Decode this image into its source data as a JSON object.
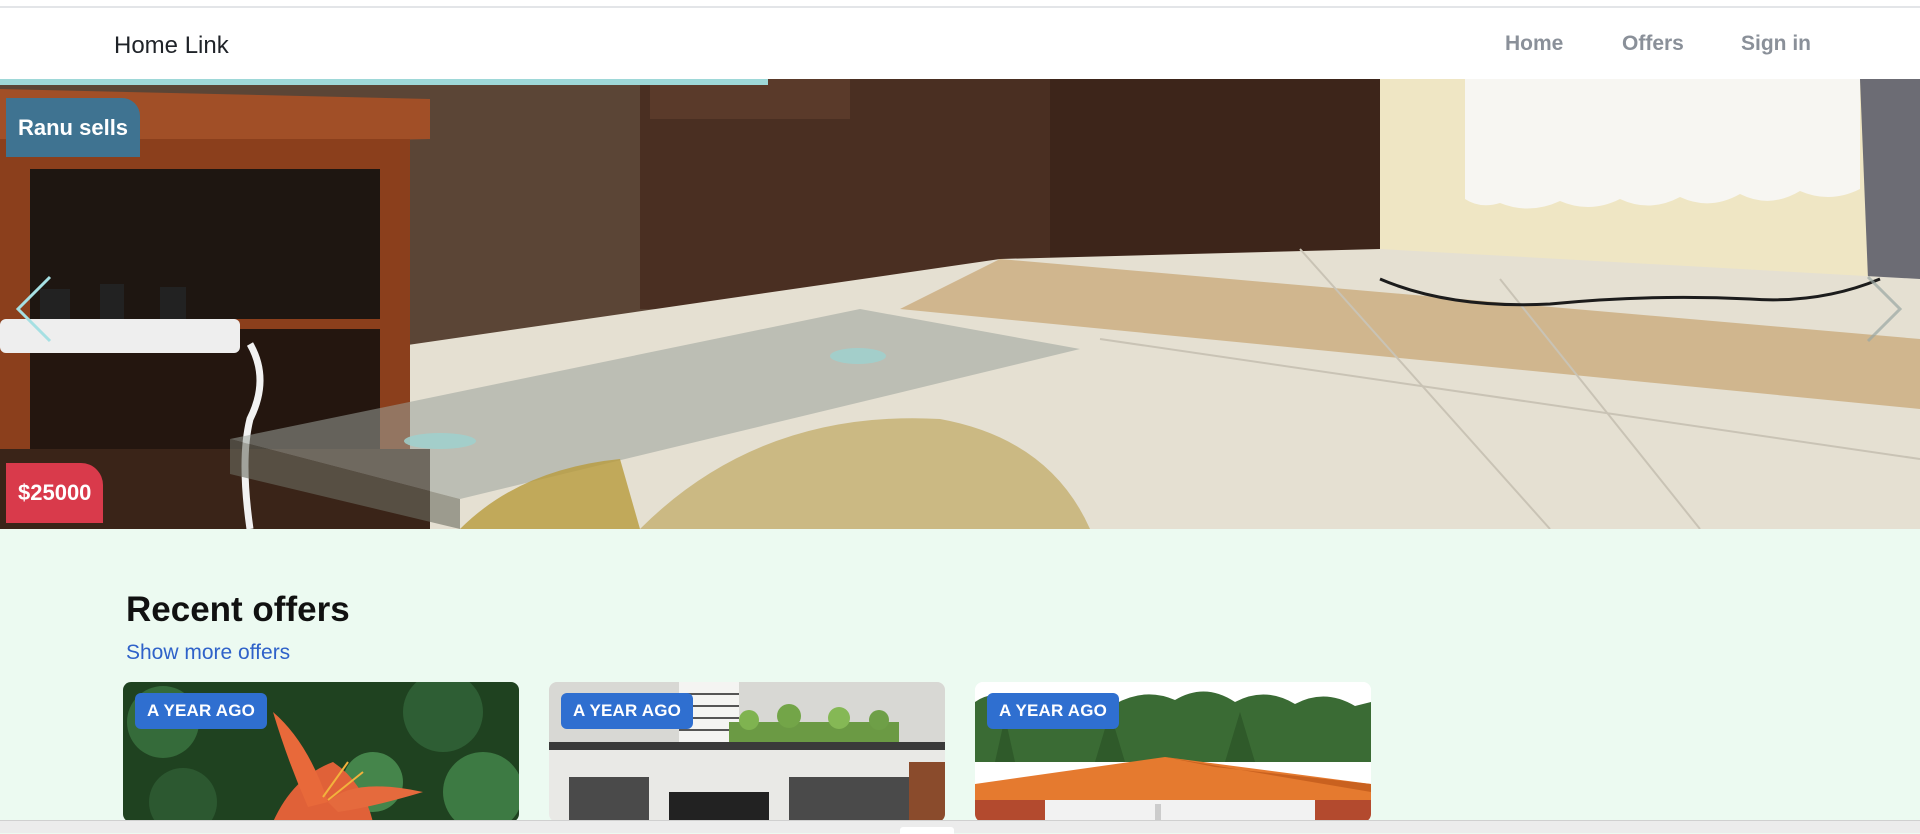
{
  "navbar": {
    "brand": "Home Link",
    "links": {
      "home": "Home",
      "offers": "Offers",
      "sign_in": "Sign in"
    }
  },
  "hero": {
    "seller": "Ranu sells",
    "price": "$25000",
    "slide_progress": 0.4,
    "icons": {
      "prev": "chevron-left-icon",
      "next": "chevron-right-icon"
    }
  },
  "recent": {
    "title": "Recent offers",
    "more_link": "Show more offers",
    "cards": [
      {
        "badge": "A YEAR AGO"
      },
      {
        "badge": "A YEAR AGO"
      },
      {
        "badge": "A YEAR AGO"
      }
    ]
  },
  "colors": {
    "page_background": "#ecfaf1",
    "seller_tag": "#3f7391",
    "price_tag": "#d93a4b",
    "badge": "#2f6fd0",
    "link": "#2f62c9",
    "progress": "#9ed8d8"
  }
}
